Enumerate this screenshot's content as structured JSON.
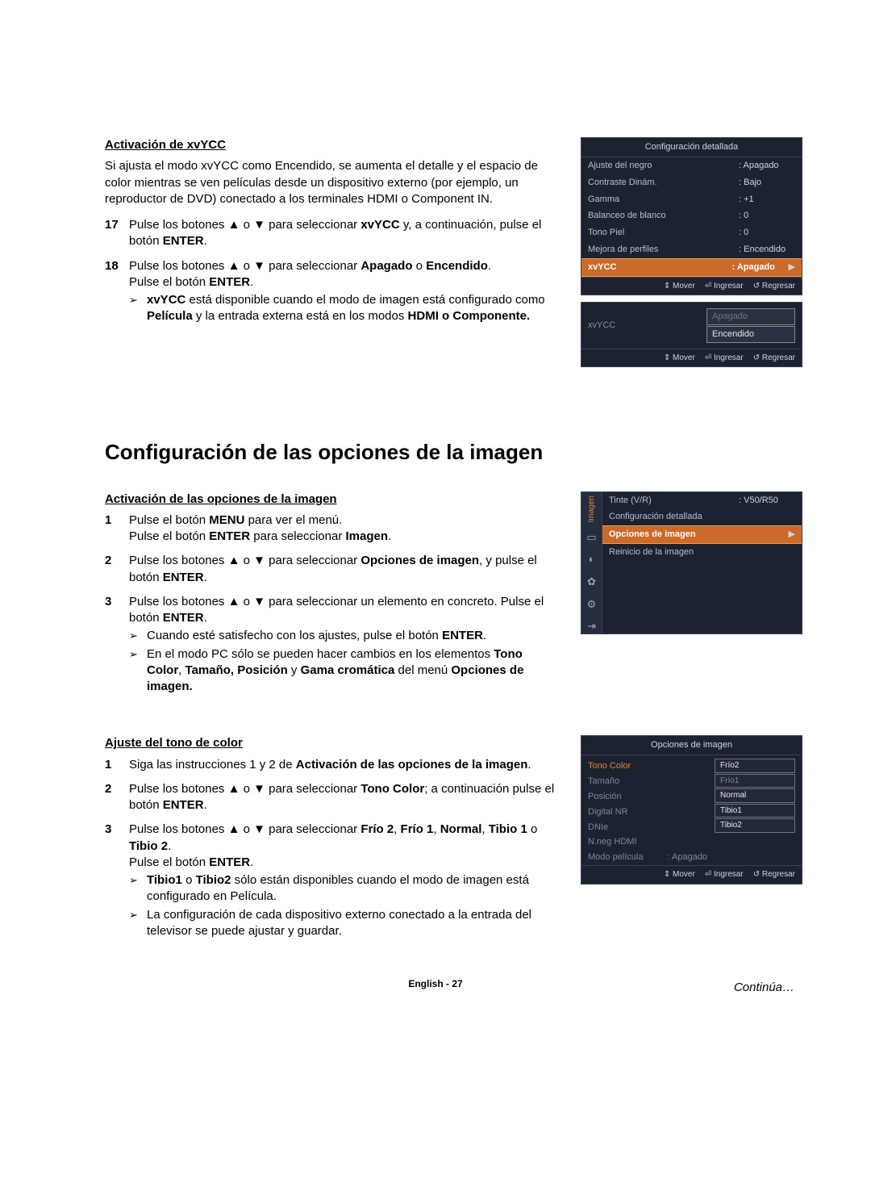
{
  "sec1": {
    "subtitle": "Activación de xvYCC",
    "intro": "Si ajusta el modo xvYCC como Encendido, se aumenta el detalle y el espacio de color mientras se ven películas desde un dispositivo externo (por ejemplo, un reproductor de DVD) conectado a los terminales HDMI o Component IN.",
    "step17_a": "Pulse los botones ▲ o ▼ para seleccionar ",
    "step17_b": "xvYCC",
    "step17_c": " y, a continuación, pulse el botón ",
    "step17_d": "ENTER",
    "step17_e": ".",
    "step18_a": "Pulse los botones ▲ o ▼ para seleccionar ",
    "step18_b": "Apagado",
    "step18_c": " o ",
    "step18_d": "Encendido",
    "step18_e": ".",
    "step18_f": "Pulse el botón ",
    "step18_g": "ENTER",
    "step18_h": ".",
    "note_a": "xvYCC",
    "note_b": " está disponible cuando el modo de imagen está configurado como ",
    "note_c": "Película",
    "note_d": " y la entrada externa está en los modos ",
    "note_e": "HDMI o Componente."
  },
  "heading": "Configuración de las opciones de la imagen",
  "sec2": {
    "subtitle": "Activación de las opciones de la imagen",
    "s1a": "Pulse el botón ",
    "s1b": "MENU",
    "s1c": " para ver el menú.",
    "s1d": "Pulse el botón ",
    "s1e": "ENTER",
    "s1f": " para seleccionar ",
    "s1g": "Imagen",
    "s1h": ".",
    "s2a": "Pulse los botones ▲ o ▼ para seleccionar ",
    "s2b": "Opciones de imagen",
    "s2c": ", y pulse el botón ",
    "s2d": "ENTER",
    "s2e": ".",
    "s3a": "Pulse los botones ▲ o ▼ para seleccionar un elemento en concreto. Pulse el botón ",
    "s3b": "ENTER",
    "s3c": ".",
    "n1a": "Cuando esté satisfecho con los ajustes, pulse el botón ",
    "n1b": "ENTER",
    "n1c": ".",
    "n2a": "En el modo PC sólo se pueden hacer cambios en los elementos ",
    "n2b": "Tono Color",
    "n2c": ", ",
    "n2d": "Tamaño, Posición",
    "n2e": " y ",
    "n2f": "Gama cromática",
    "n2g": " del menú ",
    "n2h": "Opciones de imagen."
  },
  "sec3": {
    "subtitle": "Ajuste del tono de color",
    "s1a": "Siga las instrucciones 1 y 2 de ",
    "s1b": "Activación de las opciones de la imagen",
    "s1c": ".",
    "s2a": "Pulse los botones ▲ o ▼ para seleccionar ",
    "s2b": "Tono Color",
    "s2c": "; a continuación pulse el botón ",
    "s2d": "ENTER",
    "s2e": ".",
    "s3a": "Pulse los botones ▲ o ▼ para seleccionar ",
    "s3b": "Frío 2",
    "s3c": ", ",
    "s3d": "Frío 1",
    "s3e": ", ",
    "s3f": "Normal",
    "s3g": ", ",
    "s3h": "Tibio 1",
    "s3i": " o ",
    "s3j": "Tibio 2",
    "s3k": ".",
    "s3l": "Pulse el botón ",
    "s3m": "ENTER",
    "s3n": ".",
    "n1a": "Tibio1",
    "n1b": " o ",
    "n1c": "Tibio2",
    "n1d": " sólo están disponibles cuando el modo de imagen está configurado en Película.",
    "n2": "La configuración de cada dispositivo externo conectado a la entrada del televisor se puede ajustar y guardar."
  },
  "continua": "Continúa…",
  "footer": "English - 27",
  "osd1": {
    "title": "Configuración detallada",
    "rows": [
      {
        "k": "Ajuste del negro",
        "v": ": Apagado"
      },
      {
        "k": "Contraste Dinám.",
        "v": ": Bajo"
      },
      {
        "k": "Gamma",
        "v": ": +1"
      },
      {
        "k": "Balanceo de blanco",
        "v": ": 0"
      },
      {
        "k": "Tono Piel",
        "v": ": 0"
      },
      {
        "k": "Mejora de perfiles",
        "v": ": Encendido"
      }
    ],
    "hl": {
      "k": "xvYCC",
      "v": ": Apagado"
    },
    "foot": {
      "mover": "Mover",
      "ingresar": "Ingresar",
      "regresar": "Regresar"
    }
  },
  "osd1b": {
    "label": "xvYCC",
    "apagado": "Apagado",
    "encendido": "Encendido",
    "foot": {
      "mover": "Mover",
      "ingresar": "Ingresar",
      "regresar": "Regresar"
    }
  },
  "osd2": {
    "sidetxt": "Imagen",
    "tinte_k": "Tinte (V/R)",
    "tinte_v": ": V50/R50",
    "conf": "Configuración detallada",
    "hl": "Opciones de imagen",
    "rein": "Reinicio de la imagen"
  },
  "osd3": {
    "title": "Opciones de imagen",
    "left": [
      "Tono Color",
      "Tamaño",
      "Posición",
      "Digital NR",
      "DNIe",
      "N.neg HDMI",
      "Modo película"
    ],
    "opts": [
      "Frío2",
      "Frío1",
      "Normal",
      "Tibio1",
      "Tibio2"
    ],
    "apagado": ": Apagado",
    "foot": {
      "mover": "Mover",
      "ingresar": "Ingresar",
      "regresar": "Regresar"
    }
  }
}
